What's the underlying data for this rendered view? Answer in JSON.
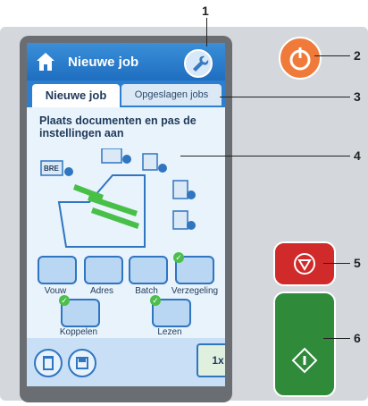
{
  "screen": {
    "header": {
      "title": "Nieuwe job"
    },
    "tabs": {
      "active": "Nieuwe job",
      "inactive": "Opgeslagen jobs"
    },
    "instruction": "Plaats documenten en pas de instellingen aan",
    "items": {
      "bre": "BRE"
    },
    "buttons": {
      "vouw": "Vouw",
      "adres": "Adres",
      "batch": "Batch",
      "verzegeling": "Verzegeling",
      "koppelen": "Koppelen",
      "lezen": "Lezen"
    },
    "footer": {
      "count": "1x"
    }
  },
  "callouts": {
    "n1": "1",
    "n2": "2",
    "n3": "3",
    "n4": "4",
    "n5": "5",
    "n6": "6"
  },
  "icons": {
    "home": "home-icon",
    "wrench": "wrench-icon",
    "power": "power-icon",
    "stop": "stop-icon",
    "start": "start-icon",
    "trash": "trash-icon",
    "save": "save-icon"
  },
  "colors": {
    "accent": "#2b7ed0",
    "power": "#f07a3a",
    "stop": "#d02a2a",
    "start": "#2f8a3a",
    "check": "#4cbe4c"
  }
}
